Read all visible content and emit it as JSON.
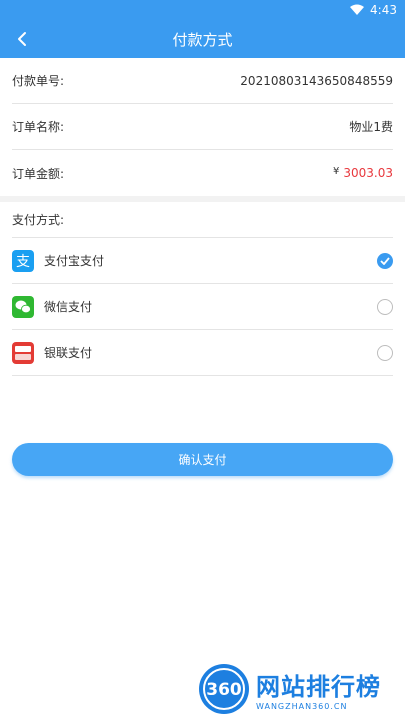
{
  "status": {
    "time": "4:43"
  },
  "nav": {
    "title": "付款方式"
  },
  "order": {
    "number_label": "付款单号:",
    "number_value": "20210803143650848559",
    "name_label": "订单名称:",
    "name_value": "物业1费",
    "amount_label": "订单金额:",
    "currency_symbol": "¥",
    "amount_value": "3003.03"
  },
  "payment": {
    "header": "支付方式:",
    "methods": [
      {
        "name": "支付宝支付",
        "icon": "alipay-icon",
        "selected": true
      },
      {
        "name": "微信支付",
        "icon": "wechat-pay-icon",
        "selected": false
      },
      {
        "name": "银联支付",
        "icon": "unionpay-icon",
        "selected": false
      }
    ]
  },
  "confirm": {
    "label": "确认支付"
  },
  "watermark": {
    "title": "网站排行榜",
    "subtitle": "WANGZHAN360.CN",
    "logo_text": "360"
  },
  "colors": {
    "primary": "#3a9bf0",
    "amount_red": "#e8383d"
  }
}
